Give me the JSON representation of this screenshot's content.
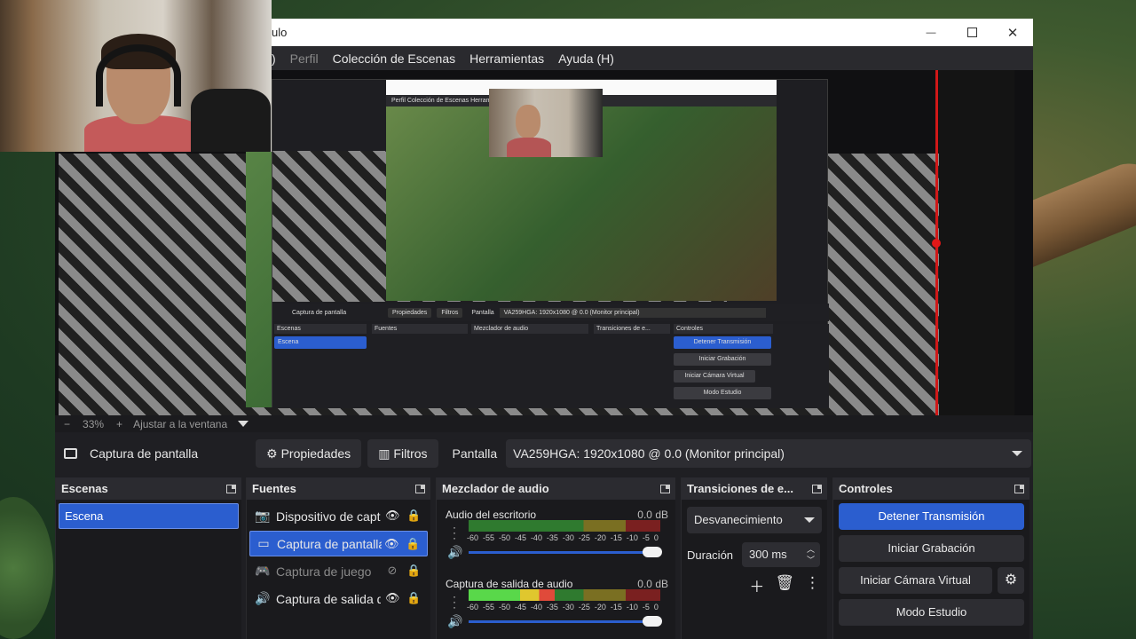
{
  "window": {
    "title_fragment": "ulo",
    "controls": {
      "minimize": "—",
      "close": "✕"
    }
  },
  "menu": {
    "items": [
      ")",
      "Perfil",
      "Colección de Escenas",
      "Herramientas",
      "Ayuda (H)"
    ]
  },
  "preview": {
    "zoom_minus": "−",
    "zoom": "33%",
    "zoom_plus": "+",
    "fit": "Ajustar a la ventana",
    "mini_menu": "Perfil   Colección de Escenas   Herramientas   Ayuda (H)",
    "mini_ctx": {
      "source": "Captura de pantalla",
      "props": "Propiedades",
      "filters": "Filtros",
      "label": "Pantalla",
      "value": "VA259HGA: 1920x1080 @ 0.0 (Monitor principal)"
    },
    "mini_docks": {
      "scenes": "Escenas",
      "scene": "Escena",
      "sources": "Fuentes",
      "mixer": "Mezclador de audio",
      "transitions": "Transiciones de e...",
      "controls": "Controles",
      "stream": "Detener Transmisión",
      "record": "Iniciar Grabación",
      "vcam": "Iniciar Cámara Virtual",
      "studio": "Modo Estudio"
    }
  },
  "context": {
    "source_name": "Captura de pantalla",
    "properties": "Propiedades",
    "filters": "Filtros",
    "display_label": "Pantalla",
    "display_value": "VA259HGA: 1920x1080 @ 0.0 (Monitor principal)"
  },
  "docks": {
    "scenes": {
      "title": "Escenas",
      "items": [
        "Escena"
      ]
    },
    "sources": {
      "title": "Fuentes",
      "items": [
        {
          "name": "Dispositivo de captura",
          "icon": "camera-icon",
          "visible": true
        },
        {
          "name": "Captura de pantalla",
          "icon": "monitor-icon",
          "visible": true,
          "selected": true
        },
        {
          "name": "Captura de juego",
          "icon": "gamepad-icon",
          "visible": false
        },
        {
          "name": "Captura de salida de audio",
          "icon": "speaker-icon",
          "visible": true
        }
      ]
    },
    "mixer": {
      "title": "Mezclador de audio",
      "ticks": [
        "-60",
        "-55",
        "-50",
        "-45",
        "-40",
        "-35",
        "-30",
        "-25",
        "-20",
        "-15",
        "-10",
        "-5",
        "0"
      ],
      "tracks": [
        {
          "name": "Audio del escritorio",
          "db": "0.0 dB",
          "level": 0.0
        },
        {
          "name": "Captura de salida de audio",
          "db": "0.0 dB",
          "level": 0.45
        }
      ]
    },
    "transitions": {
      "title": "Transiciones de e...",
      "selected": "Desvanecimiento",
      "duration_label": "Duración",
      "duration_value": "300 ms"
    },
    "controls": {
      "title": "Controles",
      "stream": "Detener Transmisión",
      "record": "Iniciar Grabación",
      "virtual_cam": "Iniciar Cámara Virtual",
      "studio": "Modo Estudio"
    }
  },
  "colors": {
    "accent": "#2b5ecf",
    "recording_red": "#d01818"
  }
}
